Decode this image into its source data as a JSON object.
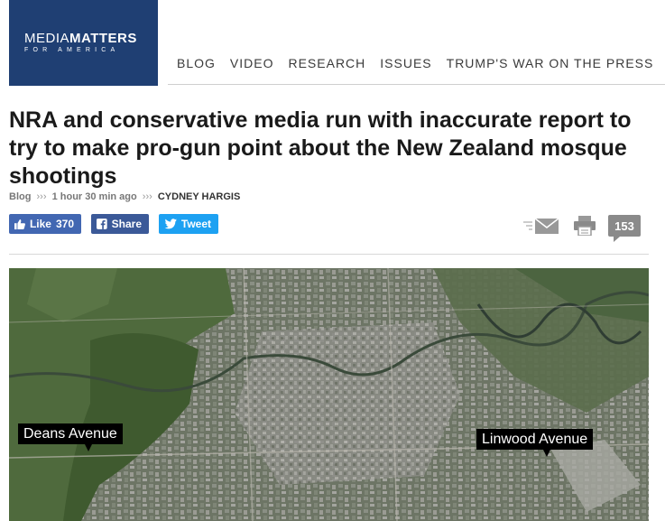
{
  "brand": {
    "name_light": "MEDIA",
    "name_bold": "MATTERS",
    "tagline": "FOR AMERICA"
  },
  "nav": {
    "items": [
      "BLOG",
      "VIDEO",
      "RESEARCH",
      "ISSUES",
      "TRUMP'S WAR ON THE PRESS"
    ]
  },
  "article": {
    "headline": "NRA and conservative media run with inaccurate report to try to make pro-gun point about the New Zealand mosque shootings",
    "category": "Blog",
    "time": "1 hour 30 min ago",
    "author": "CYDNEY HARGIS",
    "separator": "›››"
  },
  "share": {
    "like_label": "Like",
    "like_count": "370",
    "share_label": "Share",
    "tweet_label": "Tweet"
  },
  "tools": {
    "comment_count": "153"
  },
  "map": {
    "label_left": "Deans Avenue",
    "label_right": "Linwood Avenue"
  },
  "colors": {
    "brand_blue": "#1f3f73",
    "facebook": "#3b5998",
    "facebook_like": "#4267b2",
    "twitter": "#1da1f2"
  }
}
